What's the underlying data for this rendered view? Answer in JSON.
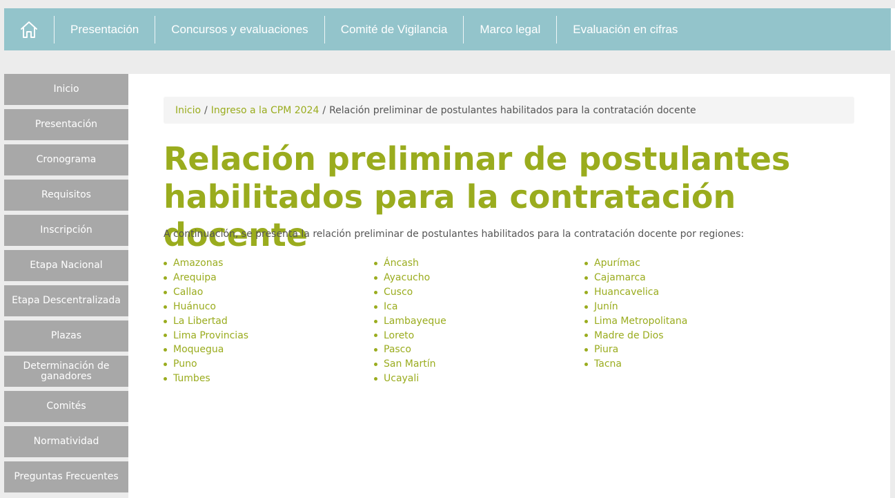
{
  "nav": {
    "home_icon": "home-icon",
    "items": [
      "Presentación",
      "Concursos y evaluaciones",
      "Comité de Vigilancia",
      "Marco legal",
      "Evaluación en cifras"
    ]
  },
  "sidebar": {
    "items": [
      "Inicio",
      "Presentación",
      "Cronograma",
      "Requisitos",
      "Inscripción",
      "Etapa Nacional",
      "Etapa Descentralizada",
      "Plazas",
      "Determinación de ganadores",
      "Comités",
      "Normatividad",
      "Preguntas Frecuentes"
    ]
  },
  "breadcrumb": {
    "home": "Inicio",
    "section": "Ingreso a la CPM 2024",
    "current": "Relación preliminar de postulantes habilitados para la contratación docente",
    "separator": "/"
  },
  "page": {
    "title": "Relación preliminar de postulantes habilitados para la contratación docente",
    "intro": "A continuación, se presenta la relación preliminar de postulantes habilitados para la contratación docente por regiones:"
  },
  "regions": {
    "col1": [
      "Amazonas",
      "Arequipa",
      "Callao",
      "Huánuco",
      "La Libertad",
      "Lima Provincias",
      "Moquegua",
      "Puno",
      "Tumbes"
    ],
    "col2": [
      "Áncash",
      "Ayacucho",
      "Cusco",
      "Ica",
      "Lambayeque",
      "Loreto",
      "Pasco",
      "San Martín",
      "Ucayali"
    ],
    "col3": [
      "Apurímac",
      "Cajamarca",
      "Huancavelica",
      "Junín",
      "Lima Metropolitana",
      "Madre de Dios",
      "Piura",
      "Tacna"
    ]
  },
  "colors": {
    "accent": "#9aac1e",
    "topbar": "#93c4cb",
    "sidebar": "#a8a8a8"
  }
}
